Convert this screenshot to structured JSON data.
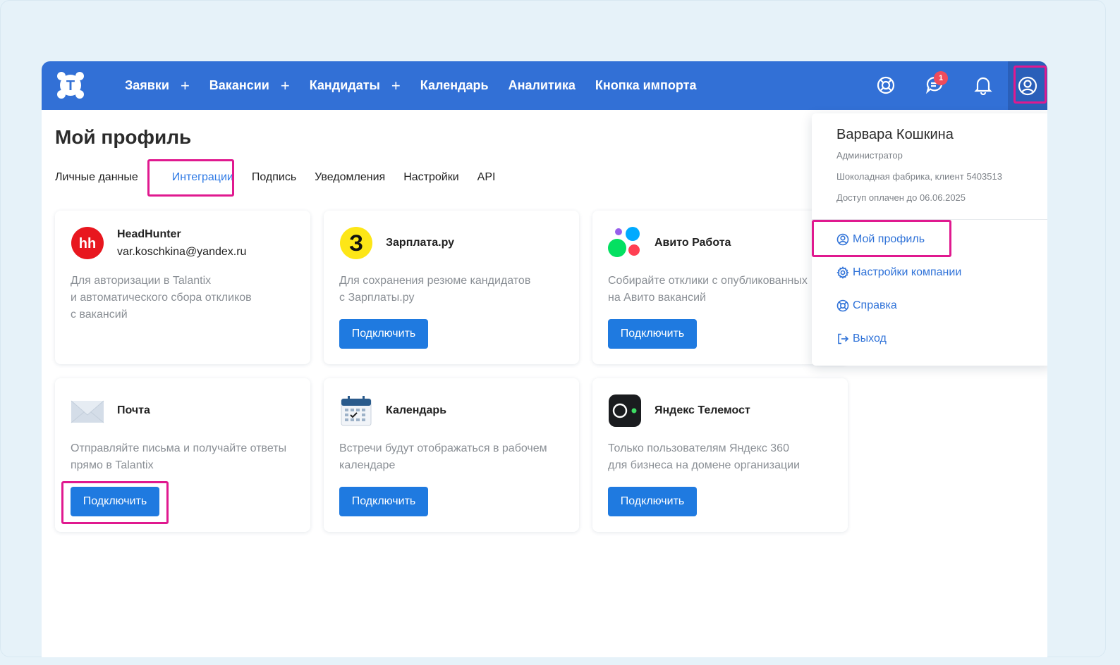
{
  "topbar": {
    "logo_letter": "T",
    "nav": [
      {
        "label": "Заявки",
        "plus": "+"
      },
      {
        "label": "Вакансии",
        "plus": "+"
      },
      {
        "label": "Кандидаты",
        "plus": "+"
      },
      {
        "label": "Календарь"
      },
      {
        "label": "Аналитика"
      },
      {
        "label": "Кнопка импорта"
      }
    ],
    "notifications_badge": "1"
  },
  "page": {
    "title": "Мой профиль",
    "tabs": [
      "Личные данные",
      "Интеграции",
      "Подпись",
      "Уведомления",
      "Настройки",
      "API"
    ],
    "active_tab": "Интеграции"
  },
  "integrations": [
    {
      "name": "HeadHunter",
      "account": "var.koschkina@yandex.ru",
      "logo_text": "hh",
      "description": "Для авторизации в Talantix\nи автоматического сбора откликов\nс вакансий"
    },
    {
      "name": "Зарплата.ру",
      "logo_text": "З",
      "description": "Для сохранения резюме кандидатов\nс Зарплаты.ру",
      "button": "Подключить"
    },
    {
      "name": "Авито Работа",
      "description": "Собирайте отклики с опубликованных\nна Авито вакансий",
      "button": "Подключить"
    },
    {
      "name": "Почта",
      "description": "Отправляйте письма и получайте ответы\nпрямо в Talantix",
      "button": "Подключить"
    },
    {
      "name": "Календарь",
      "description": "Встречи будут отображаться в рабочем\nкалендаре",
      "button": "Подключить"
    },
    {
      "name": "Яндекс Телемост",
      "description": "Только пользователям Яндекс 360\nдля бизнеса на домене организации",
      "button": "Подключить"
    }
  ],
  "profile_menu": {
    "user_name": "Варвара Кошкина",
    "role": "Администратор",
    "company": "Шоколадная фабрика, клиент 5403513",
    "access": "Доступ оплачен до 06.06.2025",
    "items": [
      "Мой профиль",
      "Настройки компании",
      "Справка",
      "Выход"
    ]
  },
  "colors": {
    "topbar": "#3270d6",
    "accent": "#1f7ae0",
    "highlight": "#e0198f",
    "hh_red": "#e8171f",
    "zarplata_yellow": "#fde617"
  }
}
